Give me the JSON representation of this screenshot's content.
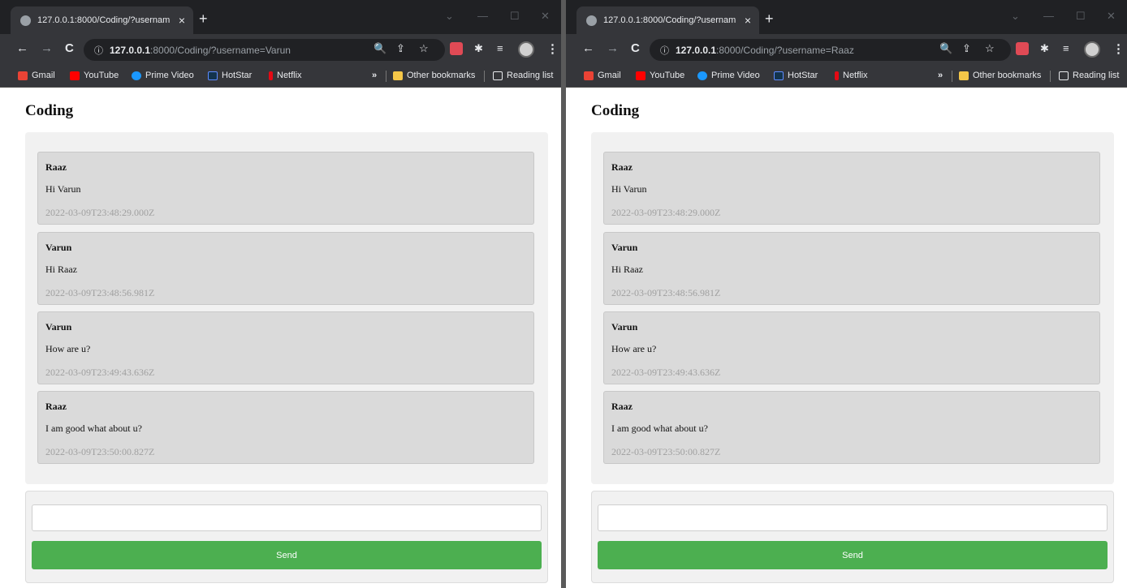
{
  "windows": [
    {
      "tab_title": "127.0.0.1:8000/Coding/?usernam",
      "url_host": "127.0.0.1",
      "url_rest": ":8000/Coding/?username=Varun",
      "room_title": "Coding",
      "messages": [
        {
          "user": "Raaz",
          "text": "Hi Varun",
          "time": "2022-03-09T23:48:29.000Z"
        },
        {
          "user": "Varun",
          "text": "Hi Raaz",
          "time": "2022-03-09T23:48:56.981Z"
        },
        {
          "user": "Varun",
          "text": "How are u?",
          "time": "2022-03-09T23:49:43.636Z"
        },
        {
          "user": "Raaz",
          "text": "I am good what about u?",
          "time": "2022-03-09T23:50:00.827Z"
        }
      ],
      "input_value": "",
      "send_label": "Send"
    },
    {
      "tab_title": "127.0.0.1:8000/Coding/?usernam",
      "url_host": "127.0.0.1",
      "url_rest": ":8000/Coding/?username=Raaz",
      "room_title": "Coding",
      "messages": [
        {
          "user": "Raaz",
          "text": "Hi Varun",
          "time": "2022-03-09T23:48:29.000Z"
        },
        {
          "user": "Varun",
          "text": "Hi Raaz",
          "time": "2022-03-09T23:48:56.981Z"
        },
        {
          "user": "Varun",
          "text": "How are u?",
          "time": "2022-03-09T23:49:43.636Z"
        },
        {
          "user": "Raaz",
          "text": "I am good what about u?",
          "time": "2022-03-09T23:50:00.827Z"
        }
      ],
      "input_value": "",
      "send_label": "Send"
    }
  ],
  "bookmarks": {
    "items": [
      "Gmail",
      "YouTube",
      "Prime Video",
      "HotStar",
      "Netflix"
    ],
    "overflow": "»",
    "other": "Other bookmarks",
    "reading_list": "Reading list"
  },
  "icons": {
    "tab_close": "×",
    "new_tab": "+",
    "back": "←",
    "forward": "→",
    "reload": "C",
    "info": "ⓘ",
    "zoom": "🔍",
    "share": "⇪",
    "star": "☆",
    "extensions": "✱",
    "media": "≡",
    "menu": "⋮",
    "minimize": "—",
    "maximize": "☐",
    "close": "✕",
    "dropdown": "⌄"
  },
  "colors": {
    "send_button": "#4caf50",
    "chrome_dark": "#202124",
    "message_bg": "#dadada"
  }
}
